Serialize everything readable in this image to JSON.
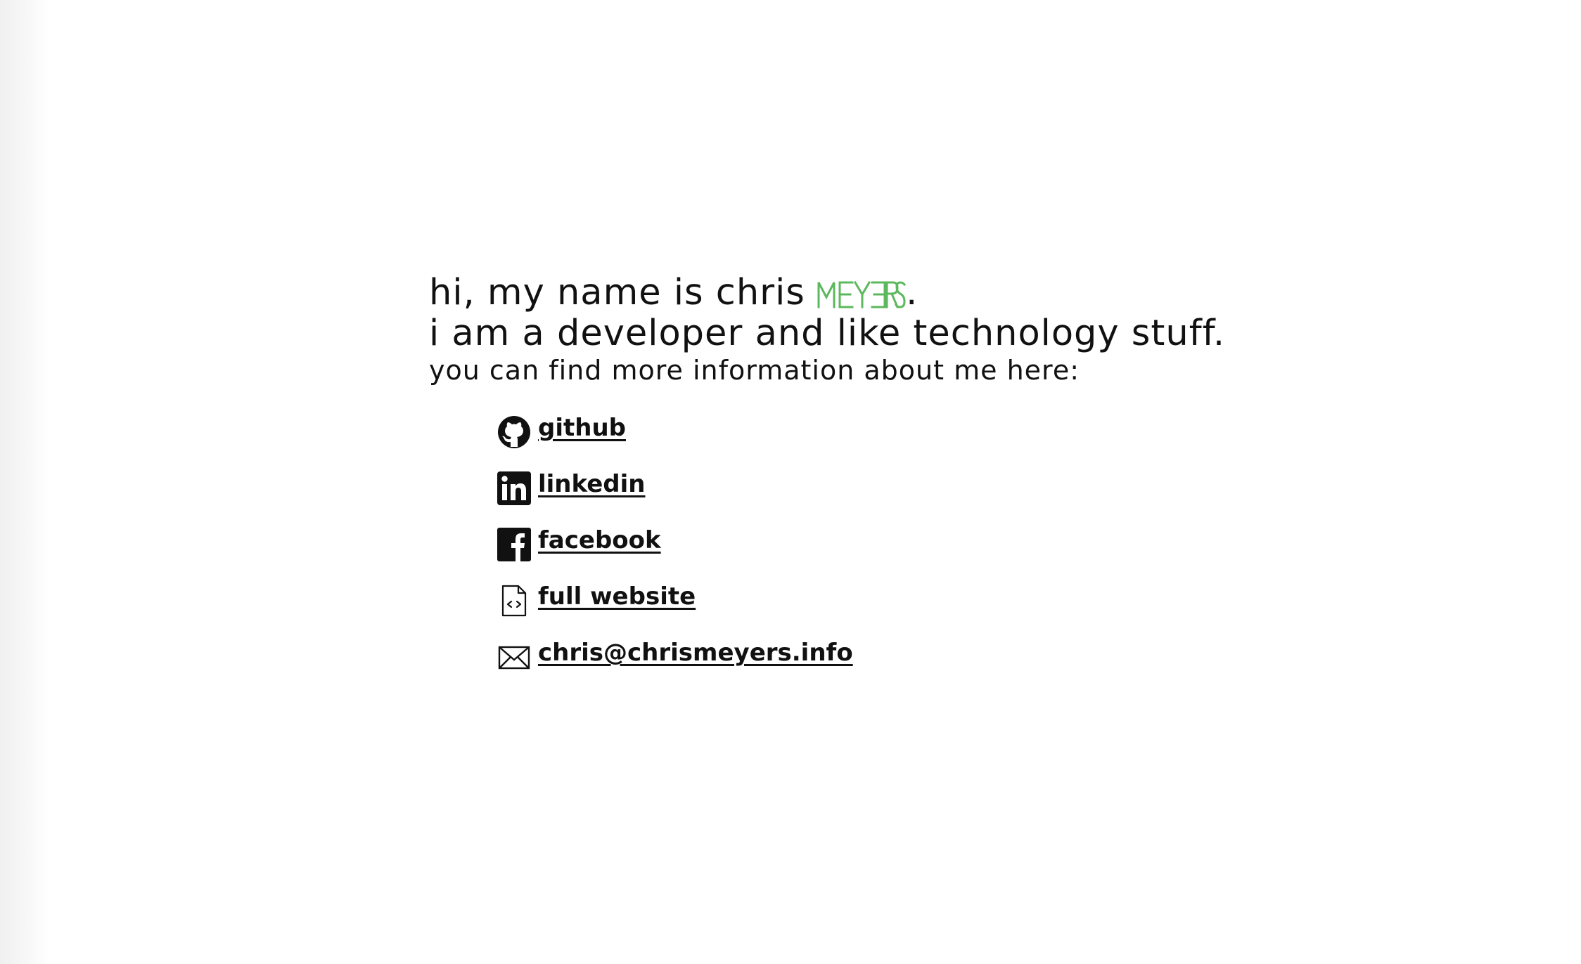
{
  "intro": {
    "line1_prefix": "hi, my name is chris ",
    "surname_logo": "MEYERS",
    "line1_suffix": ".",
    "line2": "i am a developer and like technology stuff.",
    "line3": "you can find more information about me here:"
  },
  "links": [
    {
      "label": "github",
      "icon": "github-icon"
    },
    {
      "label": "linkedin",
      "icon": "linkedin-icon"
    },
    {
      "label": "facebook",
      "icon": "facebook-icon"
    },
    {
      "label": "full website",
      "icon": "code-file-icon"
    },
    {
      "label": "chris@chrismeyers.info",
      "icon": "envelope-icon"
    }
  ],
  "colors": {
    "accent": "#5cb85c",
    "text": "#111111",
    "background": "#ffffff"
  }
}
